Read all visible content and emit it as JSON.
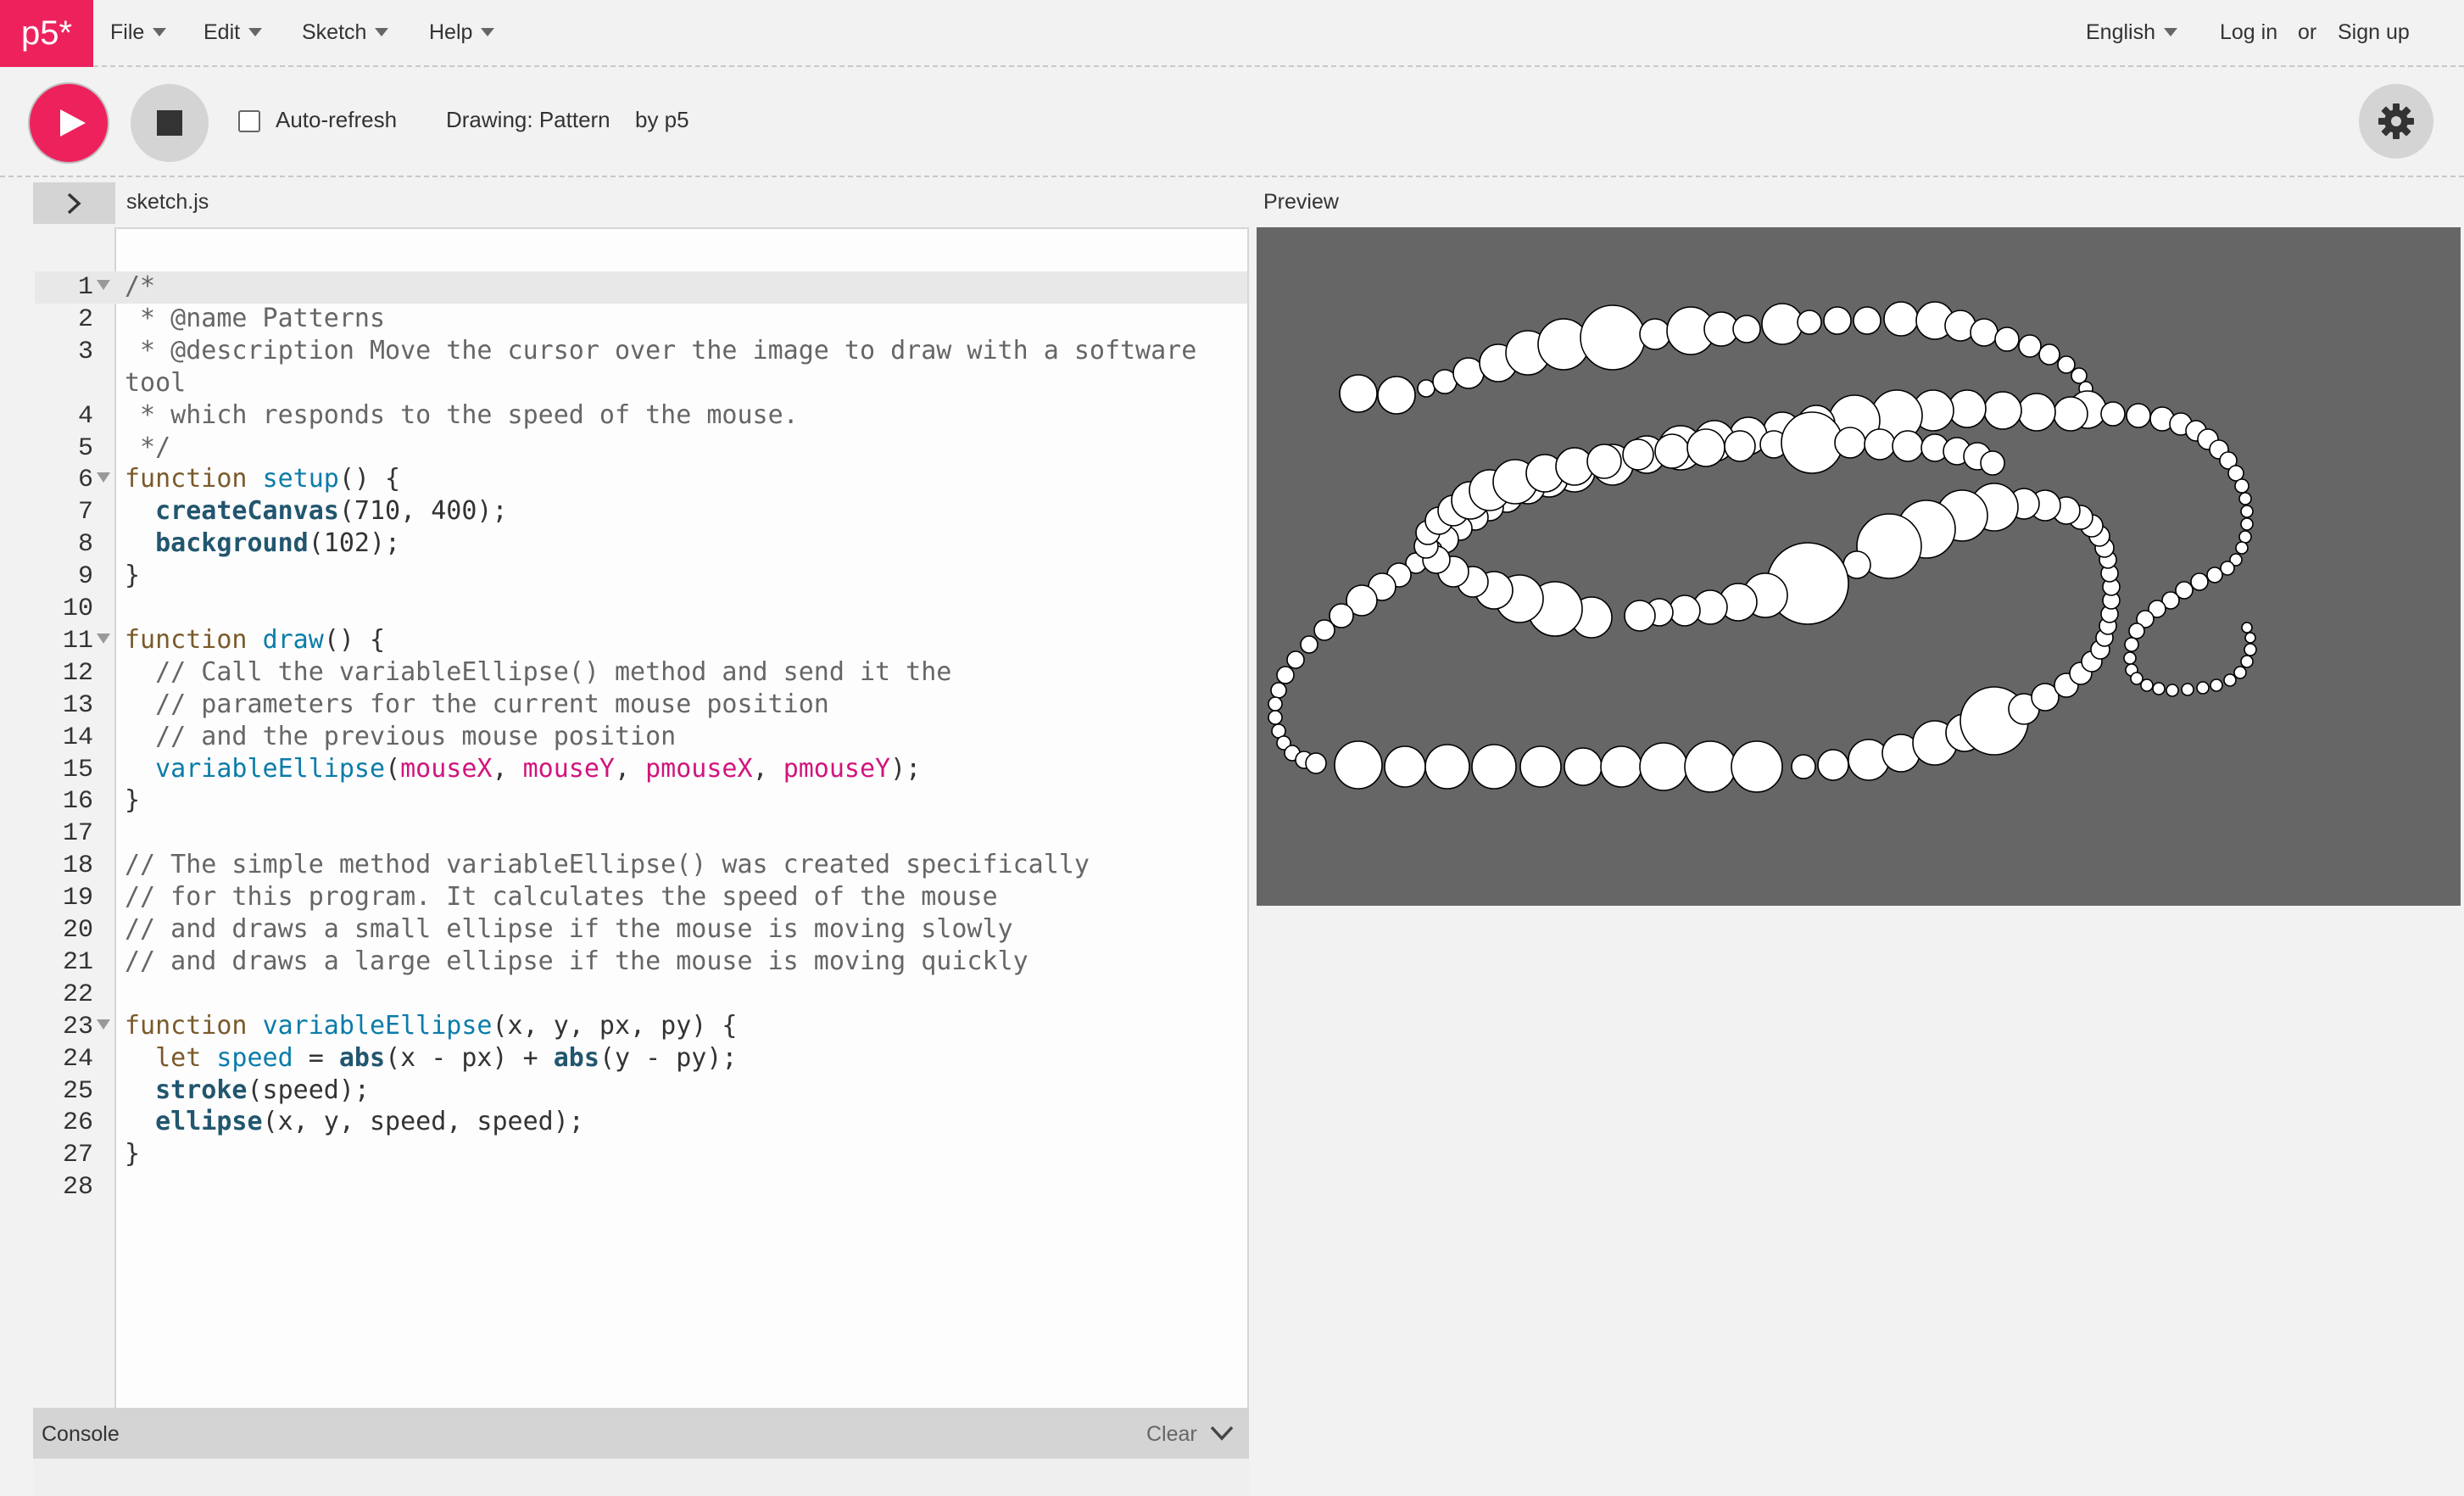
{
  "nav": {
    "logo": "p5*",
    "menus": [
      "File",
      "Edit",
      "Sketch",
      "Help"
    ],
    "language": "English",
    "login": "Log in",
    "or": "or",
    "signup": "Sign up"
  },
  "toolbar": {
    "autorefresh_label": "Auto-refresh",
    "sketch_name": "Drawing: Pattern",
    "author": "by p5"
  },
  "editor": {
    "filename": "sketch.js",
    "preview_label": "Preview",
    "lines": [
      "/*",
      " * @name Patterns",
      " * @description Move the cursor over the image to draw with a software",
      "tool",
      " * which responds to the speed of the mouse.",
      " */",
      "function setup() {",
      "  createCanvas(710, 400);",
      "  background(102);",
      "}",
      "",
      "function draw() {",
      "  // Call the variableEllipse() method and send it the",
      "  // parameters for the current mouse position",
      "  // and the previous mouse position",
      "  variableEllipse(mouseX, mouseY, pmouseX, pmouseY);",
      "}",
      "",
      "// The simple method variableEllipse() was created specifically",
      "// for this program. It calculates the speed of the mouse",
      "// and draws a small ellipse if the mouse is moving slowly",
      "// and draws a large ellipse if the mouse is moving quickly",
      "",
      "function variableEllipse(x, y, px, py) {",
      "  let speed = abs(x - px) + abs(y - py);",
      "  stroke(speed);",
      "  ellipse(x, y, speed, speed);",
      "}",
      ""
    ],
    "line_numbers": [
      "1",
      "2",
      "3",
      "",
      "4",
      "5",
      "6",
      "7",
      "8",
      "9",
      "10",
      "11",
      "12",
      "13",
      "14",
      "15",
      "16",
      "17",
      "18",
      "19",
      "20",
      "21",
      "22",
      "23",
      "24",
      "25",
      "26",
      "27",
      "28"
    ]
  },
  "console": {
    "label": "Console",
    "clear": "Clear"
  },
  "colors": {
    "accent": "#ed225d",
    "canvas_bg": "#666666"
  }
}
